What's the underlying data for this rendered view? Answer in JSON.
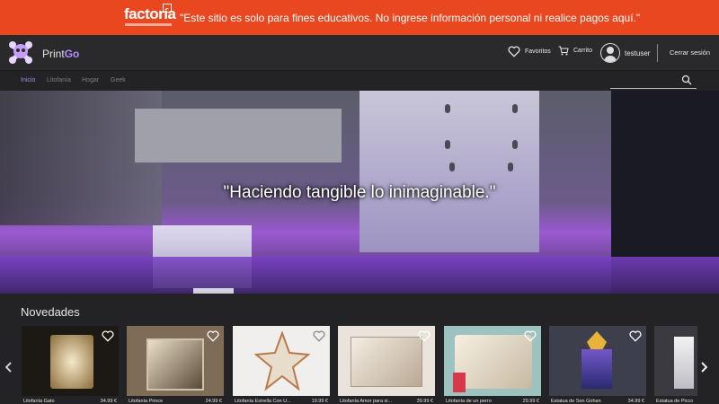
{
  "banner": {
    "logo": "factoría",
    "message": "\"Este sitio es solo para fines educativos. No ingrese información personal ni realice pagos aquí.\""
  },
  "header": {
    "brand_main": "Print",
    "brand_accent": "Go",
    "favorites_label": "Favoritos",
    "cart_label": "Carrito",
    "username": "testuser",
    "logout_label": "Cerrar sesión"
  },
  "nav": {
    "items": [
      {
        "label": "Inicio",
        "active": true
      },
      {
        "label": "Litofanía",
        "active": false
      },
      {
        "label": "Hogar",
        "active": false
      },
      {
        "label": "Geek",
        "active": false
      }
    ],
    "search_placeholder": ""
  },
  "hero": {
    "tagline": "\"Haciendo tangible lo inimaginable.\""
  },
  "section": {
    "title": "Novedades"
  },
  "products": [
    {
      "name": "Litofanía Gato",
      "price": "34.99 €"
    },
    {
      "name": "Litofanía Prince",
      "price": "24.99 €"
    },
    {
      "name": "Litofanía Estrella Con U...",
      "price": "19.99 €"
    },
    {
      "name": "Litofanía Amor para si...",
      "price": "39.99 €"
    },
    {
      "name": "Litofanía de un perro",
      "price": "29.99 €"
    },
    {
      "name": "Estatua de Son Gohan",
      "price": "34.99 €"
    },
    {
      "name": "Estatua de Picco",
      "price": ""
    }
  ],
  "carousel": {
    "prev_icon": "chevron-left-icon",
    "next_icon": "chevron-right-icon"
  },
  "colors": {
    "banner": "#e8471f",
    "accent": "#b48cff",
    "background": "#232325"
  }
}
